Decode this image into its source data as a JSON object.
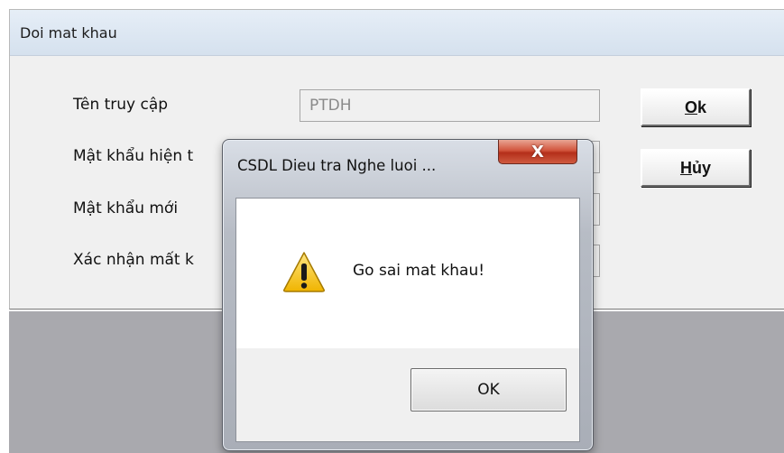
{
  "password_dialog": {
    "title": "Doi mat khau",
    "fields": [
      {
        "label": "Tên truy cập",
        "value": "PTDH"
      },
      {
        "label": "Mật khẩu hiện t",
        "value": ""
      },
      {
        "label": "Mật khẩu mới",
        "value": ""
      },
      {
        "label": "Xác nhận mất k",
        "value": ""
      }
    ],
    "ok_button": {
      "mnemonic": "O",
      "rest": "k"
    },
    "cancel_button": {
      "mnemonic": "H",
      "rest": "ủy"
    }
  },
  "message_box": {
    "title": "CSDL Dieu tra Nghe luoi ...",
    "close_icon": "close-x-icon",
    "close_glyph": "X",
    "icon": "warning-icon",
    "message": "Go sai mat khau!",
    "ok_label": "OK"
  },
  "colors": {
    "close_button": "#c84a32",
    "warning_fill": "#f5c400",
    "app_background": "#a9a9ae"
  }
}
